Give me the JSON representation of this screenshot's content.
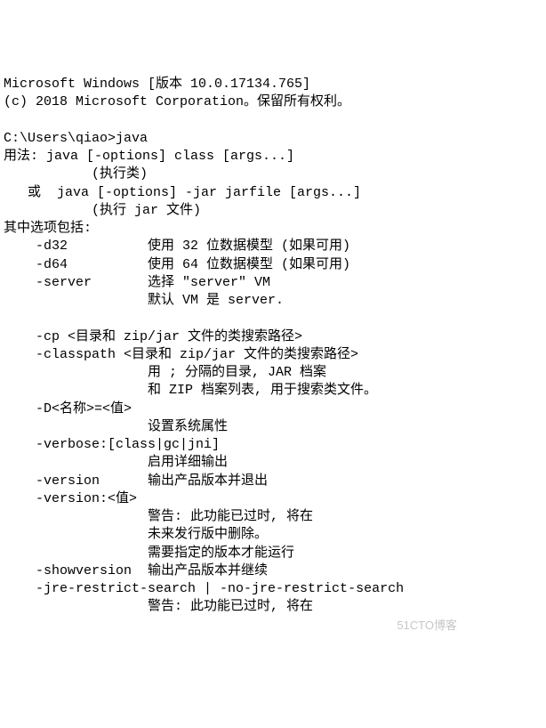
{
  "terminal": {
    "lines": [
      "Microsoft Windows [版本 10.0.17134.765]",
      "(c) 2018 Microsoft Corporation。保留所有权利。",
      "",
      "C:\\Users\\qiao>java",
      "用法: java [-options] class [args...]",
      "           (执行类)",
      "   或  java [-options] -jar jarfile [args...]",
      "           (执行 jar 文件)",
      "其中选项包括:",
      "    -d32          使用 32 位数据模型 (如果可用)",
      "    -d64          使用 64 位数据模型 (如果可用)",
      "    -server       选择 \"server\" VM",
      "                  默认 VM 是 server.",
      "",
      "    -cp <目录和 zip/jar 文件的类搜索路径>",
      "    -classpath <目录和 zip/jar 文件的类搜索路径>",
      "                  用 ; 分隔的目录, JAR 档案",
      "                  和 ZIP 档案列表, 用于搜索类文件。",
      "    -D<名称>=<值>",
      "                  设置系统属性",
      "    -verbose:[class|gc|jni]",
      "                  启用详细输出",
      "    -version      输出产品版本并退出",
      "    -version:<值>",
      "                  警告: 此功能已过时, 将在",
      "                  未来发行版中删除。",
      "                  需要指定的版本才能运行",
      "    -showversion  输出产品版本并继续",
      "    -jre-restrict-search | -no-jre-restrict-search",
      "                  警告: 此功能已过时, 将在"
    ]
  },
  "watermark": "51CTO博客"
}
